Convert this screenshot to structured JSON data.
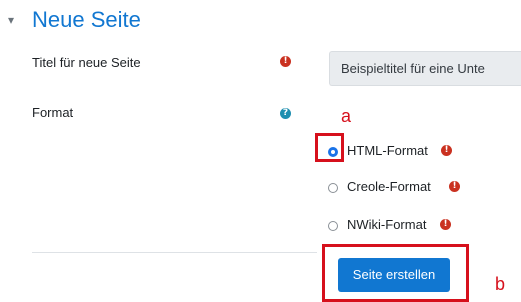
{
  "section": {
    "toggle_glyph": "▾",
    "title": "Neue Seite"
  },
  "fields": {
    "title_label": "Titel für neue Seite",
    "title_placeholder": "Beispieltitel für eine Unte",
    "format_label": "Format"
  },
  "format_options": [
    {
      "label": "HTML-Format",
      "checked": true
    },
    {
      "label": "Creole-Format",
      "checked": false
    },
    {
      "label": "NWiki-Format",
      "checked": false
    }
  ],
  "icons": {
    "required": "!",
    "help": "?"
  },
  "submit_label": "Seite erstellen",
  "annotations": {
    "a": "a",
    "b": "b"
  },
  "colors": {
    "accent": "#1177d1",
    "required": "#ca3120",
    "help": "#1f8fb0",
    "annotation": "#d6101c"
  }
}
